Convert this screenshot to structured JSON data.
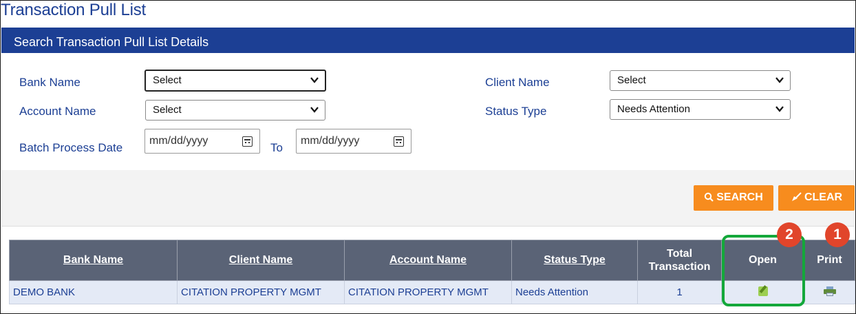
{
  "page": {
    "title": "Transaction Pull List"
  },
  "panel": {
    "header": "Search Transaction Pull List Details"
  },
  "form": {
    "bank_name_label": "Bank Name",
    "bank_name_value": "Select",
    "account_name_label": "Account Name",
    "account_name_value": "Select",
    "batch_date_label": "Batch Process Date",
    "date_from_placeholder": "mm/dd/yyyy",
    "to_label": "To",
    "date_to_placeholder": "mm/dd/yyyy",
    "client_name_label": "Client Name",
    "client_name_value": "Select",
    "status_type_label": "Status Type",
    "status_type_value": "Needs Attention"
  },
  "toolbar": {
    "search_label": "SEARCH",
    "clear_label": "CLEAR"
  },
  "table": {
    "headers": [
      "Bank Name",
      "Client Name",
      "Account Name",
      "Status Type",
      "Total Transaction",
      "Open",
      "Print"
    ],
    "rows": [
      {
        "bank": "DEMO BANK",
        "client": "CITATION PROPERTY MGMT",
        "account": "CITATION PROPERTY MGMT",
        "status": "Needs Attention",
        "total": "1",
        "open_icon": "edit-icon",
        "print_icon": "printer-icon"
      }
    ]
  },
  "annotations": {
    "badge_open": "2",
    "badge_print": "1",
    "highlight_color": "#14a83a",
    "badge_color": "#e1452b"
  },
  "colors": {
    "brand": "#1c3f94",
    "accent": "#f78c1e",
    "table_header": "#5a6376",
    "row_bg": "#e4eaf6"
  }
}
